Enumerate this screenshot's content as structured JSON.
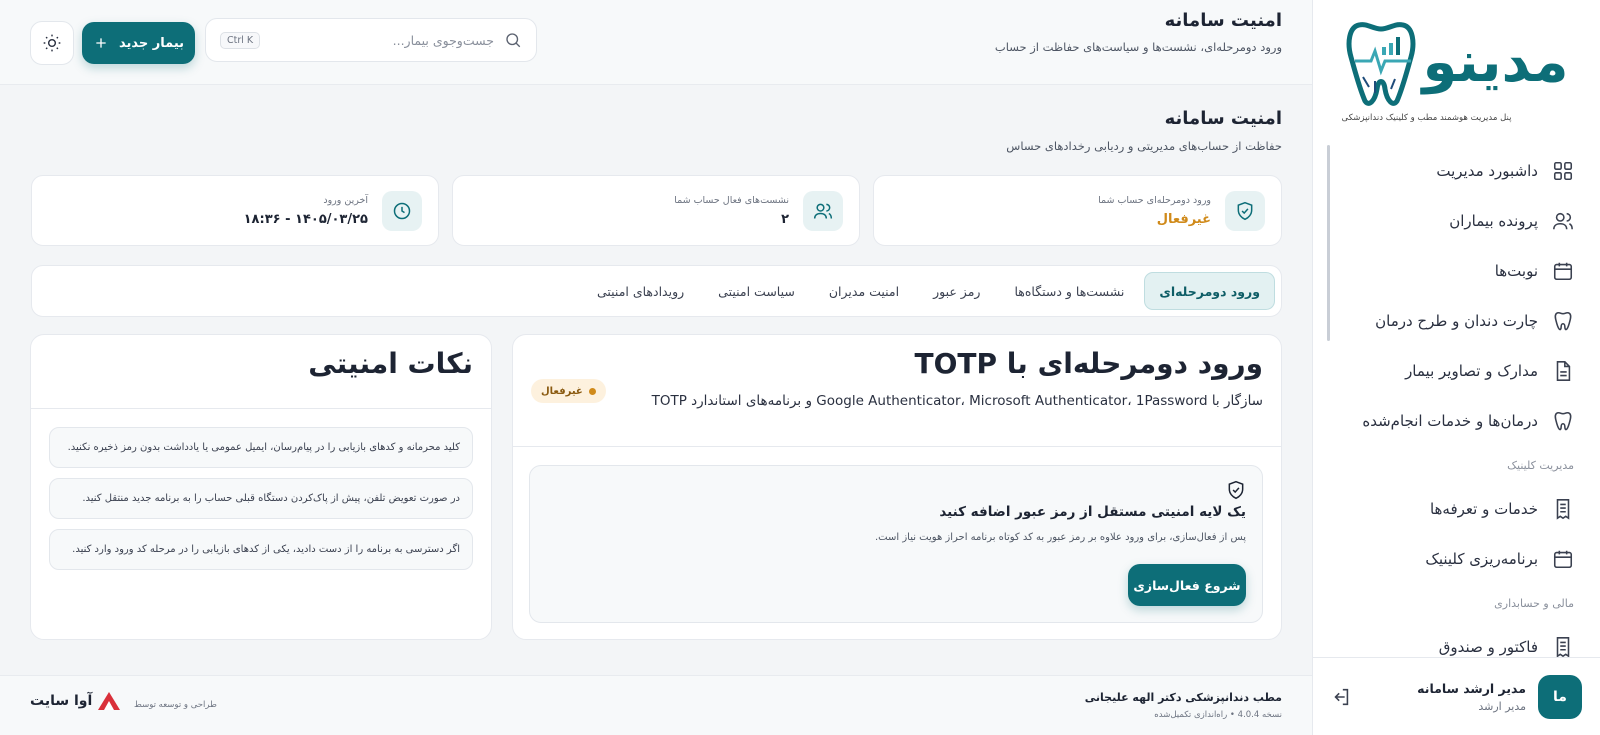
{
  "brand": {
    "name": "مدینو",
    "tagline": "پنل مدیریت هوشمند مطب و کلینیک دندانپزشکی"
  },
  "nav": {
    "items": [
      {
        "label": "داشبورد مدیریت",
        "icon": "grid-icon"
      },
      {
        "label": "پرونده بیماران",
        "icon": "users-icon"
      },
      {
        "label": "نوبت‌ها",
        "icon": "calendar-icon"
      },
      {
        "label": "چارت دندان و طرح درمان",
        "icon": "tooth-icon"
      },
      {
        "label": "مدارک و تصاویر بیمار",
        "icon": "document-icon"
      },
      {
        "label": "درمان‌ها و خدمات انجام‌شده",
        "icon": "tooth-icon"
      }
    ],
    "section_clinic": "مدیریت کلینیک",
    "clinic_items": [
      {
        "label": "خدمات و تعرفه‌ها",
        "icon": "receipt-icon"
      },
      {
        "label": "برنامه‌ریزی کلینیک",
        "icon": "calendar-icon"
      }
    ],
    "section_finance": "مالی و حسابداری",
    "finance_items": [
      {
        "label": "فاکتور و صندوق",
        "icon": "receipt-icon"
      }
    ]
  },
  "user": {
    "avatar": "ما",
    "name": "مدیر ارشد سامانه",
    "role": "مدیر ارشد"
  },
  "topbar": {
    "title": "امنیت سامانه",
    "subtitle": "ورود دومرحله‌ای، نشست‌ها و سیاست‌های حفاظت از حساب",
    "search_placeholder": "جست‌وجوی بیمار...",
    "search_shortcut": "Ctrl K",
    "new_button": "بیمار جدید"
  },
  "page": {
    "title": "امنیت سامانه",
    "subtitle": "حفاظت از حساب‌های مدیریتی و ردیابی رخدادهای حساس"
  },
  "stats": [
    {
      "label": "ورود دومرحله‌ای حساب شما",
      "value": "غیرفعال",
      "icon": "shield-check-icon"
    },
    {
      "label": "نشست‌های فعال حساب شما",
      "value": "۲",
      "icon": "users-icon"
    },
    {
      "label": "آخرین ورود",
      "value": "۱۴۰۵/۰۳/۲۵ - ۱۸:۳۶",
      "icon": "clock-icon"
    }
  ],
  "tabs": [
    {
      "label": "ورود دومرحله‌ای",
      "active": true
    },
    {
      "label": "نشست‌ها و دستگاه‌ها"
    },
    {
      "label": "رمز عبور"
    },
    {
      "label": "امنیت مدیران"
    },
    {
      "label": "سیاست امنیتی"
    },
    {
      "label": "رویدادهای امنیتی"
    }
  ],
  "totp": {
    "title": "ورود دومرحله‌ای با TOTP",
    "subtitle": "سازگار با Google Authenticator، Microsoft Authenticator، 1Password و برنامه‌های استاندارد TOTP",
    "badge": "غیرفعال",
    "box_title": "یک لایه امنیتی مستقل از رمز عبور اضافه کنید",
    "box_desc": "پس از فعال‌سازی، برای ورود علاوه بر رمز عبور به کد کوتاه برنامه احراز هویت نیاز است.",
    "button": "شروع فعال‌سازی"
  },
  "tips": {
    "title": "نکات امنیتی",
    "items": [
      "کلید محرمانه و کدهای بازیابی را در پیام‌رسان، ایمیل عمومی یا یادداشت بدون رمز ذخیره نکنید.",
      "در صورت تعویض تلفن، پیش از پاک‌کردن دستگاه قبلی حساب را به برنامه جدید منتقل کنید.",
      "اگر دسترسی به برنامه را از دست دادید، یکی از کدهای بازیابی را در مرحله کد ورود وارد کنید."
    ]
  },
  "footer": {
    "title": "مطب دندانپزشکی دکتر الهه علیجانی",
    "version": "نسخه 4.0.4 • راه‌اندازی تکمیل‌شده",
    "designed_by": "طراحی و توسعه توسط",
    "company": "آوا سایت"
  },
  "colors": {
    "accent": "#0d6e78",
    "warning": "#d08a1a"
  }
}
